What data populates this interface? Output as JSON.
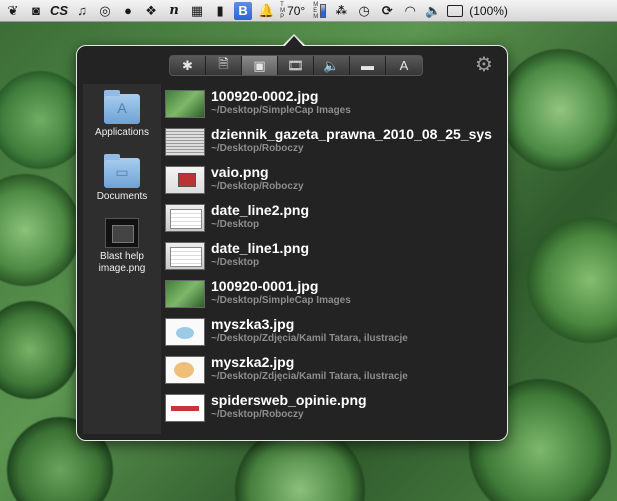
{
  "menubar": {
    "temperature": "70°",
    "battery": "(100%)"
  },
  "toolbar": {
    "buttons": [
      {
        "name": "all",
        "glyph": "✱"
      },
      {
        "name": "documents",
        "glyph": "🗎"
      },
      {
        "name": "images",
        "glyph": "▣"
      },
      {
        "name": "movies",
        "glyph": "🎞"
      },
      {
        "name": "audio",
        "glyph": "🔈"
      },
      {
        "name": "folders",
        "glyph": "▬"
      },
      {
        "name": "applications",
        "glyph": "A"
      }
    ],
    "selected": "images"
  },
  "sidebar": {
    "items": [
      {
        "label": "Applications"
      },
      {
        "label": "Documents"
      },
      {
        "label": "Blast help image.png"
      }
    ]
  },
  "files": [
    {
      "name": "100920-0002.jpg",
      "path": "~/Desktop/SimpleCap Images"
    },
    {
      "name": "dziennik_gazeta_prawna_2010_08_25_sys",
      "path": "~/Desktop/Roboczy"
    },
    {
      "name": "vaio.png",
      "path": "~/Desktop/Roboczy"
    },
    {
      "name": "date_line2.png",
      "path": "~/Desktop"
    },
    {
      "name": "date_line1.png",
      "path": "~/Desktop"
    },
    {
      "name": "100920-0001.jpg",
      "path": "~/Desktop/SimpleCap Images"
    },
    {
      "name": "myszka3.jpg",
      "path": "~/Desktop/Zdjęcia/Kamil Tatara, ilustracje"
    },
    {
      "name": "myszka2.jpg",
      "path": "~/Desktop/Zdjęcia/Kamil Tatara, ilustracje"
    },
    {
      "name": "spidersweb_opinie.png",
      "path": "~/Desktop/Roboczy"
    }
  ]
}
